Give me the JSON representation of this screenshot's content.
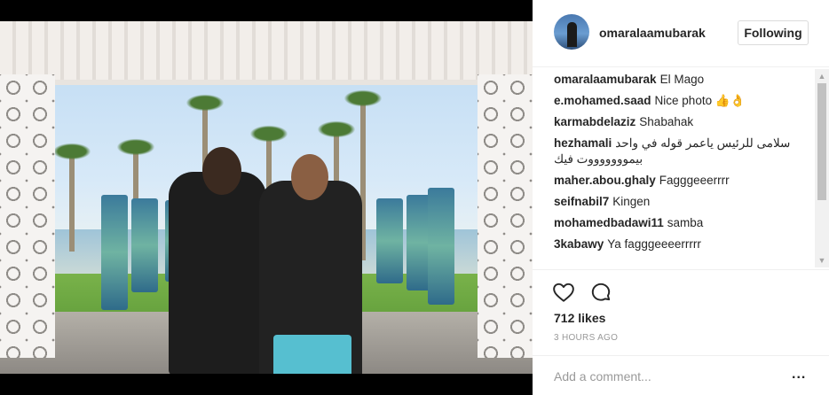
{
  "post": {
    "author": "omaralaamubarak",
    "follow_label": "Following",
    "comments": [
      {
        "user": "omaralaamubarak",
        "text": "El Mago"
      },
      {
        "user": "e.mohamed.saad",
        "text": "Nice photo 👍👌"
      },
      {
        "user": "karmabdelaziz",
        "text": "Shabahak"
      },
      {
        "user": "hezhamali",
        "text": "سلامى للرئيس ياعمر قوله في واحد",
        "text2": "بيموووووووت فيك"
      },
      {
        "user": "maher.abou.ghaly",
        "text": "Fagggeeerrrr"
      },
      {
        "user": "seifnabil7",
        "text": "Kingen"
      },
      {
        "user": "mohamedbadawi11",
        "text": "samba"
      },
      {
        "user": "3kabawy",
        "text": "Ya fagggeeeerrrrr"
      }
    ],
    "likes": "712 likes",
    "time": "3 HOURS AGO",
    "comment_placeholder": "Add a comment...",
    "more_label": "..."
  },
  "icons": {
    "like": "heart-icon",
    "comment": "speech-bubble-icon",
    "scroll_up": "scroll-up-arrow-icon",
    "scroll_down": "scroll-down-arrow-icon"
  }
}
